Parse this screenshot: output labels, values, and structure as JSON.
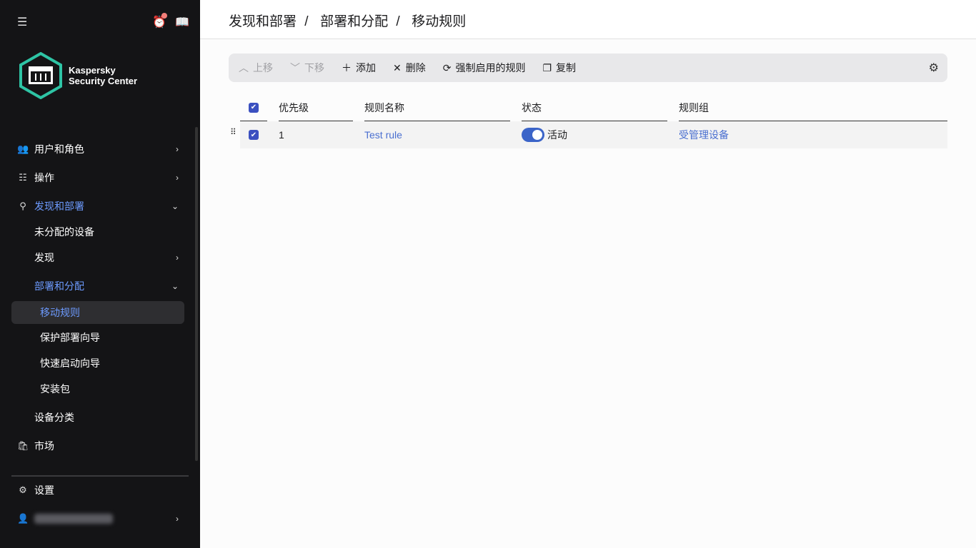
{
  "brand": {
    "line1": "Kaspersky",
    "line2": "Security Center"
  },
  "sidebar": {
    "items": [
      {
        "label": "用户和角色"
      },
      {
        "label": "操作"
      },
      {
        "label": "发现和部署"
      },
      {
        "label": "未分配的设备"
      },
      {
        "label": "发现"
      },
      {
        "label": "部署和分配"
      },
      {
        "label": "移动规则"
      },
      {
        "label": "保护部署向导"
      },
      {
        "label": "快速启动向导"
      },
      {
        "label": "安装包"
      },
      {
        "label": "设备分类"
      },
      {
        "label": "市场"
      }
    ],
    "settings": "设置"
  },
  "breadcrumb": [
    "发现和部署",
    "部署和分配",
    "移动规则"
  ],
  "toolbar": {
    "up": "上移",
    "down": "下移",
    "add": "添加",
    "delete": "删除",
    "force": "强制启用的规则",
    "copy": "复制"
  },
  "table": {
    "headers": [
      "优先级",
      "规则名称",
      "状态",
      "规则组"
    ],
    "rows": [
      {
        "priority": "1",
        "name": "Test rule",
        "status": "活动",
        "group": "受管理设备",
        "enabled": true,
        "checked": true
      }
    ]
  },
  "colors": {
    "accent": "#3b64c8",
    "sidebar": "#141416",
    "active": "#6d9bff"
  }
}
